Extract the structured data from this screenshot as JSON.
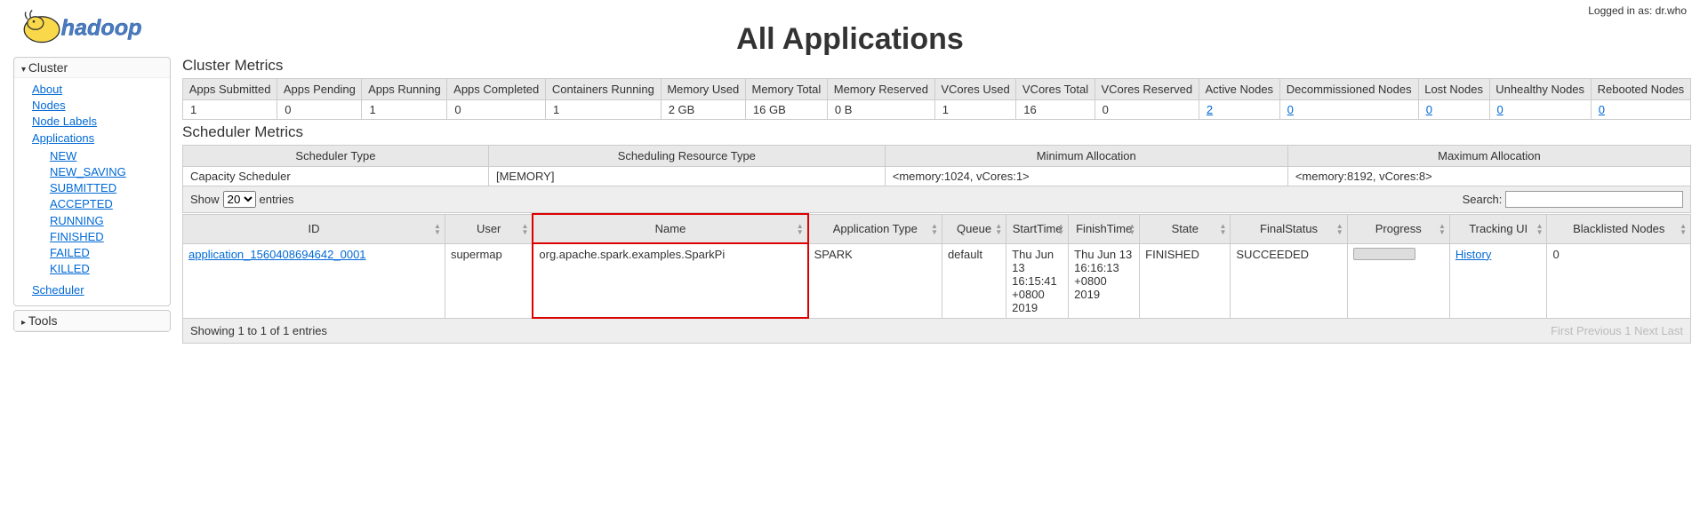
{
  "login": {
    "label": "Logged in as: dr.who"
  },
  "title": "All Applications",
  "sidebar": {
    "cluster": {
      "header": "Cluster",
      "links": [
        "About",
        "Nodes",
        "Node Labels",
        "Applications"
      ],
      "app_states": [
        "NEW",
        "NEW_SAVING",
        "SUBMITTED",
        "ACCEPTED",
        "RUNNING",
        "FINISHED",
        "FAILED",
        "KILLED"
      ],
      "scheduler": "Scheduler"
    },
    "tools": {
      "header": "Tools"
    }
  },
  "cluster_metrics": {
    "title": "Cluster Metrics",
    "headers": [
      "Apps Submitted",
      "Apps Pending",
      "Apps Running",
      "Apps Completed",
      "Containers Running",
      "Memory Used",
      "Memory Total",
      "Memory Reserved",
      "VCores Used",
      "VCores Total",
      "VCores Reserved",
      "Active Nodes",
      "Decommissioned Nodes",
      "Lost Nodes",
      "Unhealthy Nodes",
      "Rebooted Nodes"
    ],
    "values": [
      "1",
      "0",
      "1",
      "0",
      "1",
      "2 GB",
      "16 GB",
      "0 B",
      "1",
      "16",
      "0",
      "2",
      "0",
      "0",
      "0",
      "0"
    ],
    "linkable": [
      false,
      false,
      false,
      false,
      false,
      false,
      false,
      false,
      false,
      false,
      false,
      true,
      true,
      true,
      true,
      true
    ]
  },
  "scheduler_metrics": {
    "title": "Scheduler Metrics",
    "headers": [
      "Scheduler Type",
      "Scheduling Resource Type",
      "Minimum Allocation",
      "Maximum Allocation"
    ],
    "values": [
      "Capacity Scheduler",
      "[MEMORY]",
      "<memory:1024, vCores:1>",
      "<memory:8192, vCores:8>"
    ]
  },
  "controls": {
    "show": "Show",
    "entries": "entries",
    "page_size": "20",
    "search_label": "Search:"
  },
  "apps_table": {
    "headers": [
      "ID",
      "User",
      "Name",
      "Application Type",
      "Queue",
      "StartTime",
      "FinishTime",
      "State",
      "FinalStatus",
      "Progress",
      "Tracking UI",
      "Blacklisted Nodes"
    ],
    "row": {
      "id": "application_1560408694642_0001",
      "user": "supermap",
      "name": "org.apache.spark.examples.SparkPi",
      "type": "SPARK",
      "queue": "default",
      "start": "Thu Jun 13 16:15:41 +0800 2019",
      "finish": "Thu Jun 13 16:16:13 +0800 2019",
      "state": "FINISHED",
      "final": "SUCCEEDED",
      "tracking": "History",
      "blacklisted": "0"
    }
  },
  "footer": {
    "info": "Showing 1 to 1 of 1 entries",
    "paging": [
      "First",
      "Previous",
      "1",
      "Next",
      "Last"
    ]
  }
}
